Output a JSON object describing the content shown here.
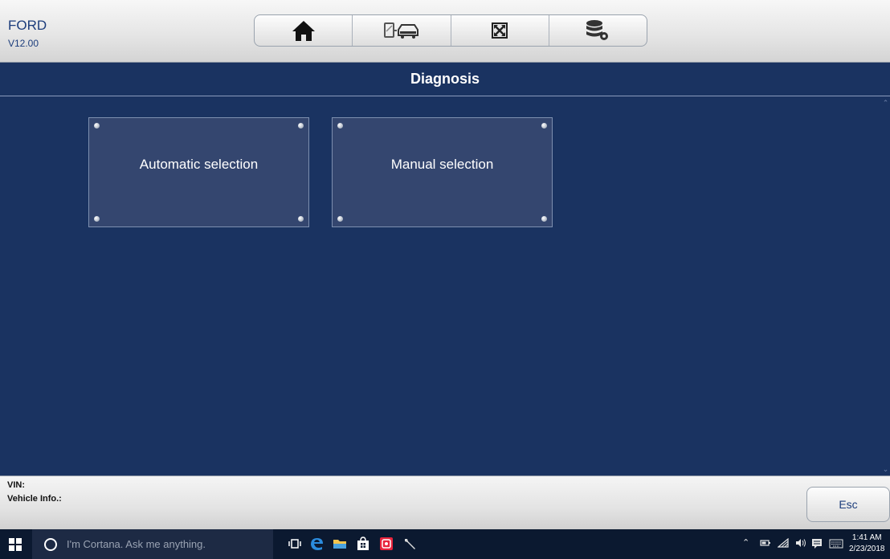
{
  "header": {
    "brand": "FORD",
    "version": "V12.00",
    "toolbar": [
      {
        "icon": "home-icon"
      },
      {
        "icon": "vehicle-connect-icon"
      },
      {
        "icon": "fullscreen-icon"
      },
      {
        "icon": "database-settings-icon"
      }
    ]
  },
  "page": {
    "title": "Diagnosis"
  },
  "tiles": [
    {
      "label": "Automatic selection"
    },
    {
      "label": "Manual selection"
    }
  ],
  "footer": {
    "vin_label": "VIN:",
    "vehicle_info_label": "Vehicle Info.:",
    "esc_label": "Esc"
  },
  "taskbar": {
    "search_placeholder": "I'm Cortana. Ask me anything.",
    "time": "1:41 AM",
    "date": "2/23/2018"
  },
  "colors": {
    "background": "#1a3361",
    "tile": "#34466f",
    "accent_text": "#1c3d7c"
  }
}
